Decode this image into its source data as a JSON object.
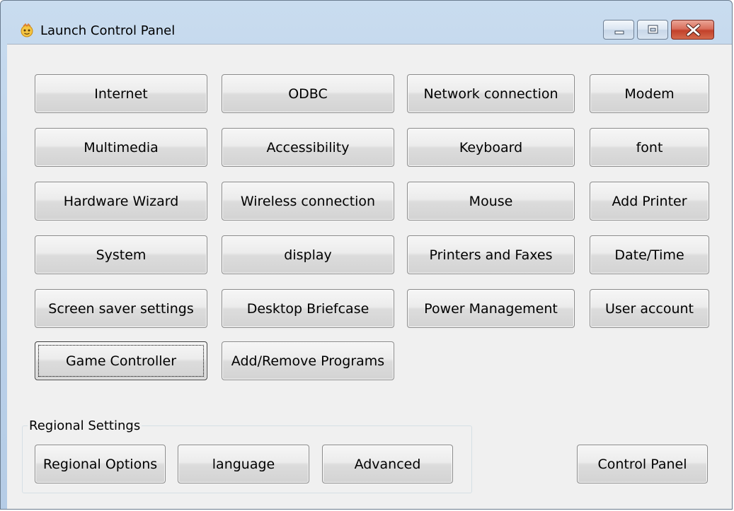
{
  "window": {
    "title": "Launch Control Panel",
    "icon": "app-face-icon",
    "controls": {
      "minimize": "minimize-icon",
      "maximize": "maximize-icon",
      "close": "close-icon"
    }
  },
  "buttons": {
    "internet": "Internet",
    "odbc": "ODBC",
    "network_connection": "Network connection",
    "modem": "Modem",
    "multimedia": "Multimedia",
    "accessibility": "Accessibility",
    "keyboard": "Keyboard",
    "font": "font",
    "hardware_wizard": "Hardware Wizard",
    "wireless_connection": "Wireless connection",
    "mouse": "Mouse",
    "add_printer": "Add Printer",
    "system": "System",
    "display": "display",
    "printers_faxes": "Printers and Faxes",
    "date_time": "Date/Time",
    "screen_saver": "Screen saver settings",
    "desktop_briefcase": "Desktop Briefcase",
    "power_management": "Power Management",
    "user_account": "User account",
    "game_controller": "Game Controller",
    "add_remove_programs": "Add/Remove Programs"
  },
  "regional": {
    "group_label": "Regional Settings",
    "regional_options": "Regional Options",
    "language": "language",
    "advanced": "Advanced"
  },
  "control_panel": "Control Panel",
  "focused_button": "Game Controller"
}
